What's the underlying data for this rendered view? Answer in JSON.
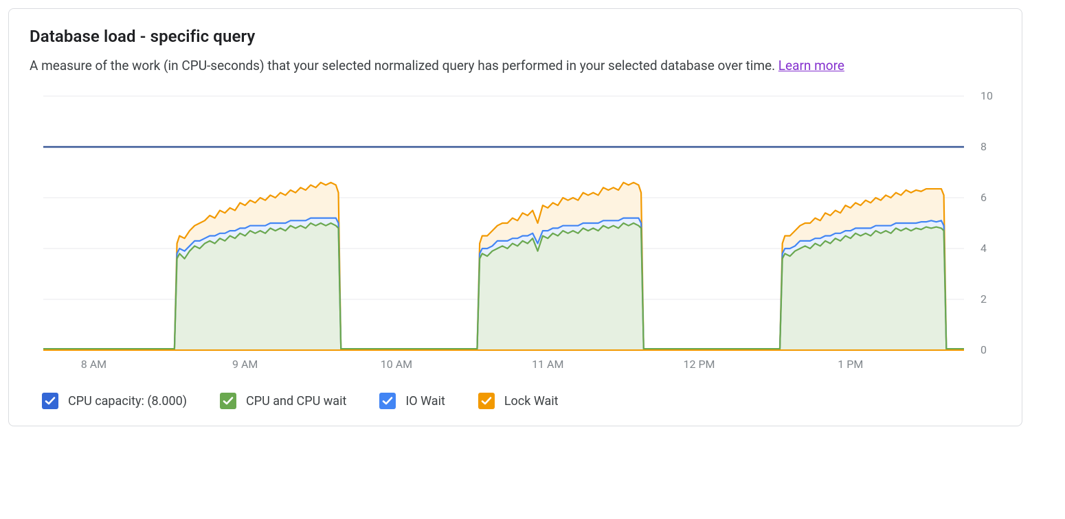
{
  "title": "Database load - specific query",
  "subtitle_prefix": "A measure of the work (in CPU-seconds) that your selected normalized query has performed in your selected database over time. ",
  "subtitle_link": "Learn more",
  "legend": {
    "cpu_capacity": "CPU capacity: (8.000)",
    "cpu_wait": "CPU and CPU wait",
    "io_wait": "IO Wait",
    "lock_wait": "Lock Wait"
  },
  "colors": {
    "cpu_capacity_line": "#3b5998",
    "cpu_wait_fill": "#e6f0e1",
    "cpu_wait_box": "#6aa84f",
    "io_wait_line": "#4285f4",
    "io_wait_fill": "#e8f0fe",
    "lock_wait_line": "#f29900",
    "lock_wait_fill": "#fef3e0",
    "grid": "#e8eaed",
    "tick_text": "#80868b"
  },
  "chart_data": {
    "type": "area",
    "ylim": [
      0,
      10
    ],
    "ytick_labels": [
      "0",
      "2",
      "4",
      "6",
      "8",
      "10"
    ],
    "xtick_labels": [
      "8 AM",
      "9 AM",
      "10 AM",
      "11 AM",
      "12 PM",
      "1 PM"
    ],
    "xtick_positions_min": [
      0,
      60,
      120,
      180,
      240,
      300
    ],
    "x_range_min": [
      -20,
      345
    ],
    "cpu_capacity_value": 8.0,
    "series": [
      {
        "name": "CPU and CPU wait",
        "color_line": "#6aa84f",
        "color_fill": "#e6f0e1",
        "stack_order": 0,
        "x_min": [
          -20,
          32,
          33,
          34,
          36,
          38,
          40,
          42,
          44,
          46,
          48,
          50,
          52,
          54,
          56,
          58,
          60,
          62,
          64,
          66,
          68,
          70,
          72,
          74,
          76,
          78,
          80,
          82,
          84,
          86,
          88,
          90,
          92,
          94,
          96,
          97,
          98,
          152,
          153,
          154,
          156,
          158,
          160,
          162,
          164,
          166,
          168,
          170,
          172,
          174,
          176,
          178,
          180,
          182,
          184,
          186,
          188,
          190,
          192,
          194,
          196,
          198,
          200,
          202,
          204,
          206,
          208,
          210,
          212,
          214,
          216,
          217,
          218,
          272,
          273,
          274,
          276,
          278,
          280,
          282,
          284,
          286,
          288,
          290,
          292,
          294,
          296,
          298,
          300,
          302,
          304,
          306,
          308,
          310,
          312,
          314,
          316,
          318,
          320,
          322,
          324,
          326,
          328,
          330,
          332,
          334,
          336,
          337,
          338,
          345
        ],
        "y": [
          0.05,
          0.05,
          3.6,
          3.8,
          3.6,
          3.9,
          4.1,
          4.0,
          4.2,
          4.3,
          4.2,
          4.4,
          4.3,
          4.5,
          4.4,
          4.6,
          4.5,
          4.7,
          4.6,
          4.7,
          4.6,
          4.8,
          4.7,
          4.8,
          4.7,
          4.9,
          4.8,
          4.9,
          4.8,
          5.0,
          4.9,
          5.0,
          4.9,
          5.0,
          4.9,
          4.8,
          0.05,
          0.05,
          3.6,
          3.8,
          3.7,
          3.9,
          4.0,
          4.1,
          4.0,
          4.2,
          4.1,
          4.3,
          4.2,
          4.4,
          3.9,
          4.5,
          4.4,
          4.6,
          4.5,
          4.7,
          4.6,
          4.7,
          4.6,
          4.8,
          4.7,
          4.8,
          4.7,
          4.9,
          4.8,
          4.9,
          4.8,
          5.0,
          4.9,
          5.0,
          4.9,
          4.8,
          0.05,
          0.05,
          3.6,
          3.8,
          3.7,
          3.9,
          4.0,
          4.1,
          4.0,
          4.2,
          4.1,
          4.3,
          4.2,
          4.4,
          4.3,
          4.5,
          4.4,
          4.6,
          4.5,
          4.6,
          4.5,
          4.7,
          4.6,
          4.7,
          4.6,
          4.8,
          4.7,
          4.8,
          4.7,
          4.8,
          4.75,
          4.85,
          4.8,
          4.85,
          4.8,
          4.7,
          0.05,
          0.05
        ]
      },
      {
        "name": "IO Wait",
        "color_line": "#4285f4",
        "color_fill": "#e8f0fe",
        "stack_order": 1,
        "x_min": [
          -20,
          32,
          33,
          34,
          36,
          38,
          40,
          42,
          44,
          46,
          48,
          50,
          52,
          54,
          56,
          58,
          60,
          62,
          64,
          66,
          68,
          70,
          72,
          74,
          76,
          78,
          80,
          82,
          84,
          86,
          88,
          90,
          92,
          94,
          96,
          97,
          98,
          152,
          153,
          154,
          156,
          158,
          160,
          162,
          164,
          166,
          168,
          170,
          172,
          174,
          176,
          178,
          180,
          182,
          184,
          186,
          188,
          190,
          192,
          194,
          196,
          198,
          200,
          202,
          204,
          206,
          208,
          210,
          212,
          214,
          216,
          217,
          218,
          272,
          273,
          274,
          276,
          278,
          280,
          282,
          284,
          286,
          288,
          290,
          292,
          294,
          296,
          298,
          300,
          302,
          304,
          306,
          308,
          310,
          312,
          314,
          316,
          318,
          320,
          322,
          324,
          326,
          328,
          330,
          332,
          334,
          336,
          337,
          338,
          345
        ],
        "y": [
          0.0,
          0.0,
          0.2,
          0.2,
          0.3,
          0.2,
          0.2,
          0.3,
          0.2,
          0.2,
          0.3,
          0.2,
          0.3,
          0.2,
          0.3,
          0.2,
          0.3,
          0.2,
          0.3,
          0.2,
          0.3,
          0.2,
          0.3,
          0.2,
          0.3,
          0.2,
          0.3,
          0.2,
          0.3,
          0.2,
          0.3,
          0.2,
          0.3,
          0.2,
          0.3,
          0.2,
          0.0,
          0.0,
          0.2,
          0.2,
          0.3,
          0.2,
          0.3,
          0.2,
          0.3,
          0.2,
          0.3,
          0.2,
          0.3,
          0.2,
          0.3,
          0.2,
          0.3,
          0.2,
          0.3,
          0.2,
          0.3,
          0.2,
          0.3,
          0.2,
          0.3,
          0.2,
          0.3,
          0.2,
          0.3,
          0.2,
          0.3,
          0.2,
          0.3,
          0.2,
          0.3,
          0.2,
          0.0,
          0.0,
          0.2,
          0.2,
          0.3,
          0.2,
          0.3,
          0.2,
          0.3,
          0.2,
          0.3,
          0.2,
          0.3,
          0.2,
          0.3,
          0.2,
          0.3,
          0.2,
          0.3,
          0.2,
          0.3,
          0.2,
          0.3,
          0.2,
          0.3,
          0.2,
          0.3,
          0.2,
          0.3,
          0.2,
          0.3,
          0.2,
          0.3,
          0.2,
          0.3,
          0.2,
          0.0,
          0.0
        ]
      },
      {
        "name": "Lock Wait",
        "color_line": "#f29900",
        "color_fill": "#fef3e0",
        "stack_order": 2,
        "x_min": [
          -20,
          32,
          33,
          34,
          36,
          38,
          40,
          42,
          44,
          46,
          48,
          50,
          52,
          54,
          56,
          58,
          60,
          62,
          64,
          66,
          68,
          70,
          72,
          74,
          76,
          78,
          80,
          82,
          84,
          86,
          88,
          90,
          92,
          94,
          96,
          97,
          98,
          152,
          153,
          154,
          156,
          158,
          160,
          162,
          164,
          166,
          168,
          170,
          172,
          174,
          176,
          178,
          180,
          182,
          184,
          186,
          188,
          190,
          192,
          194,
          196,
          198,
          200,
          202,
          204,
          206,
          208,
          210,
          212,
          214,
          216,
          217,
          218,
          272,
          273,
          274,
          276,
          278,
          280,
          282,
          284,
          286,
          288,
          290,
          292,
          294,
          296,
          298,
          300,
          302,
          304,
          306,
          308,
          310,
          312,
          314,
          316,
          318,
          320,
          322,
          324,
          326,
          328,
          330,
          332,
          334,
          336,
          337,
          338,
          345
        ],
        "y": [
          0.0,
          0.0,
          0.4,
          0.5,
          0.5,
          0.6,
          0.6,
          0.7,
          0.7,
          0.8,
          0.7,
          0.9,
          0.8,
          0.9,
          0.8,
          1.0,
          0.9,
          1.0,
          0.9,
          1.1,
          1.0,
          1.1,
          1.0,
          1.2,
          1.1,
          1.2,
          1.1,
          1.3,
          1.2,
          1.3,
          1.2,
          1.4,
          1.3,
          1.4,
          1.3,
          1.2,
          0.0,
          0.0,
          0.4,
          0.5,
          0.5,
          0.6,
          0.6,
          0.7,
          0.7,
          0.8,
          0.7,
          0.9,
          0.8,
          0.9,
          0.8,
          1.0,
          0.9,
          1.0,
          0.9,
          1.1,
          1.0,
          1.1,
          1.0,
          1.2,
          1.1,
          1.2,
          1.1,
          1.3,
          1.2,
          1.3,
          1.2,
          1.4,
          1.3,
          1.4,
          1.3,
          1.2,
          0.0,
          0.0,
          0.4,
          0.5,
          0.5,
          0.6,
          0.6,
          0.7,
          0.7,
          0.8,
          0.7,
          0.9,
          0.8,
          0.9,
          0.8,
          1.0,
          0.9,
          1.0,
          0.9,
          1.1,
          1.0,
          1.1,
          1.0,
          1.2,
          1.1,
          1.2,
          1.1,
          1.3,
          1.2,
          1.3,
          1.2,
          1.3,
          1.25,
          1.3,
          1.25,
          1.2,
          0.0,
          0.0
        ]
      }
    ]
  }
}
